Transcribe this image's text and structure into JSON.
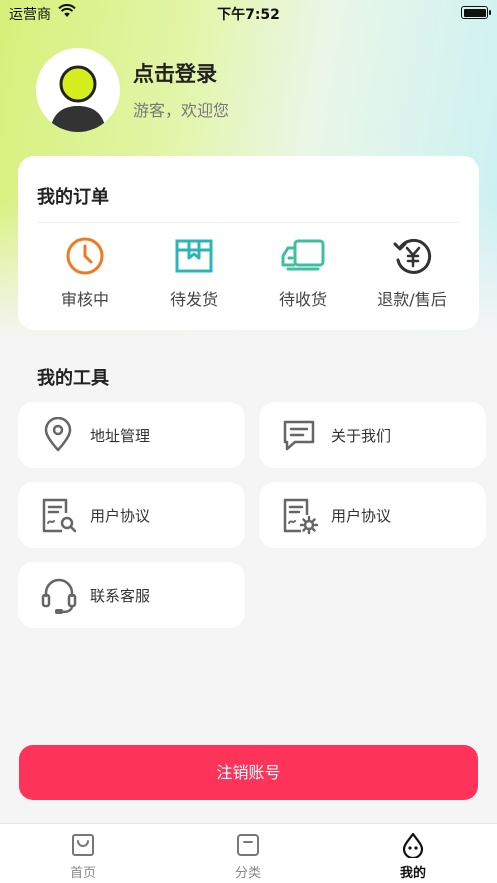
{
  "status_bar": {
    "carrier": "运营商",
    "time": "下午7:52"
  },
  "profile": {
    "login_title": "点击登录",
    "subtitle": "游客，欢迎您"
  },
  "orders": {
    "title": "我的订单",
    "items": [
      {
        "label": "审核中",
        "icon": "clock-icon",
        "color": "#f07a20"
      },
      {
        "label": "待发货",
        "icon": "box-icon",
        "color": "#2bb5b8"
      },
      {
        "label": "待收货",
        "icon": "truck-icon",
        "color": "#3cc0a0"
      },
      {
        "label": "退款/售后",
        "icon": "refund-yuan-icon",
        "color": "#333333"
      }
    ]
  },
  "tools": {
    "title": "我的工具",
    "items": [
      {
        "label": "地址管理",
        "icon": "location-pin-icon"
      },
      {
        "label": "关于我们",
        "icon": "message-icon"
      },
      {
        "label": "用户协议",
        "icon": "document-search-icon"
      },
      {
        "label": "用户协议",
        "icon": "document-settings-icon"
      },
      {
        "label": "联系客服",
        "icon": "headset-icon"
      }
    ]
  },
  "logout_label": "注销账号",
  "tab_bar": {
    "items": [
      {
        "label": "首页",
        "icon": "shopping-bag-icon",
        "active": false
      },
      {
        "label": "分类",
        "icon": "category-icon",
        "active": false
      },
      {
        "label": "我的",
        "icon": "profile-drop-icon",
        "active": true
      }
    ]
  },
  "colors": {
    "accent": "#fd3359",
    "background": "#f5f5f5",
    "card": "#ffffff"
  }
}
